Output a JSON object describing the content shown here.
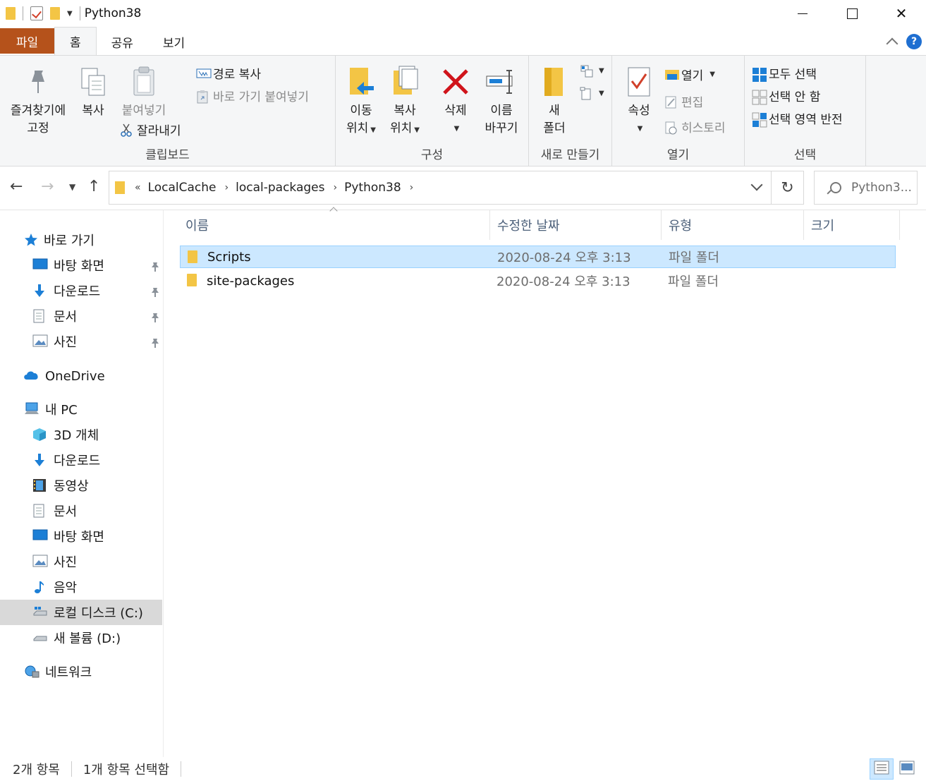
{
  "window": {
    "title": "Python38"
  },
  "ribbon_tabs": {
    "file": "파일",
    "home": "홈",
    "share": "공유",
    "view": "보기"
  },
  "ribbon": {
    "clipboard": {
      "pin_line1": "즐겨찾기에",
      "pin_line2": "고정",
      "copy": "복사",
      "paste": "붙여넣기",
      "copy_path": "경로 복사",
      "paste_shortcut": "바로 가기 붙여넣기",
      "cut": "잘라내기",
      "label": "클립보드"
    },
    "organize": {
      "move_line1": "이동",
      "move_line2": "위치",
      "copyto_line1": "복사",
      "copyto_line2": "위치",
      "delete": "삭제",
      "rename_line1": "이름",
      "rename_line2": "바꾸기",
      "label": "구성"
    },
    "new": {
      "folder_line1": "새",
      "folder_line2": "폴더",
      "label": "새로 만들기"
    },
    "open": {
      "properties": "속성",
      "open": "열기",
      "edit": "편집",
      "history": "히스토리",
      "label": "열기"
    },
    "select": {
      "select_all": "모두 선택",
      "select_none": "선택 안 함",
      "invert": "선택 영역 반전",
      "label": "선택"
    }
  },
  "address": {
    "overflow": "«",
    "crumbs": [
      "LocalCache",
      "local-packages",
      "Python38"
    ],
    "search_placeholder": "Python3..."
  },
  "nav": {
    "quick_access": "바로 가기",
    "qa_items": [
      "바탕 화면",
      "다운로드",
      "문서",
      "사진"
    ],
    "onedrive": "OneDrive",
    "this_pc": "내 PC",
    "pc_items": [
      "3D 개체",
      "다운로드",
      "동영상",
      "문서",
      "바탕 화면",
      "사진",
      "음악",
      "로컬 디스크 (C:)",
      "새 볼륨 (D:)"
    ],
    "network": "네트워크"
  },
  "columns": {
    "name": "이름",
    "date": "수정한 날짜",
    "type": "유형",
    "size": "크기"
  },
  "files": [
    {
      "name": "Scripts",
      "date": "2020-08-24 오후 3:13",
      "type": "파일 폴더",
      "selected": true
    },
    {
      "name": "site-packages",
      "date": "2020-08-24 오후 3:13",
      "type": "파일 폴더",
      "selected": false
    }
  ],
  "status": {
    "count": "2개 항목",
    "selected": "1개 항목 선택함"
  },
  "colors": {
    "file_tab": "#b5521b",
    "selection": "#cce8ff",
    "folder": "#f3c545",
    "delete_red": "#d0141b"
  }
}
